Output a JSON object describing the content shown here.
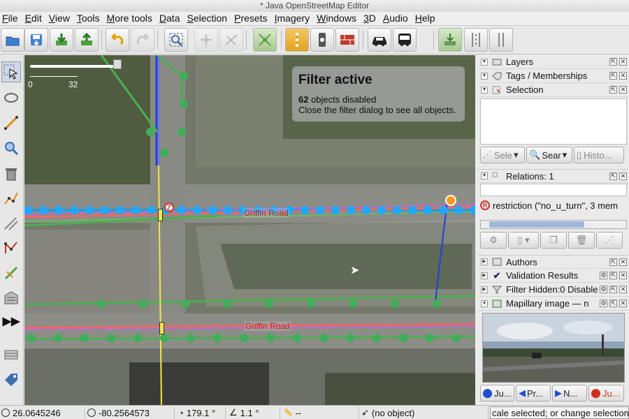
{
  "window": {
    "title": "* Java OpenStreetMap Editor"
  },
  "menu": [
    "File",
    "Edit",
    "View",
    "Tools",
    "More tools",
    "Data",
    "Selection",
    "Presets",
    "Imagery",
    "Windows",
    "3D",
    "Audio",
    "Help"
  ],
  "toolbar_icons": [
    "open-file-icon",
    "save-icon",
    "download-icon",
    "upload-icon",
    "undo-icon",
    "redo-icon",
    "zoom-to-selection-icon",
    "preferences-icon",
    "wireframe-icon",
    "split-way-icon",
    "traffic-signals-icon",
    "railway-crossing-icon",
    "barrier-icon",
    "car-icon",
    "bus-icon",
    "download-bounds-icon",
    "sidewalk-icon",
    "crossing-icon"
  ],
  "left_tools": [
    "select-tool",
    "lasso-tool",
    "draw-nodes-tool",
    "zoom-tool",
    "delete-tool",
    "improve-way-tool",
    "parallel-tool",
    "extrude-tool",
    "join-nodes-tool",
    "building-tool",
    "more-tools",
    "sidebar-toggle",
    "tag-tool"
  ],
  "map": {
    "scale": {
      "start": "0",
      "end": "32"
    },
    "filter": {
      "title": "Filter active",
      "count": "62",
      "line1_suffix": " objects disabled",
      "line2": "Close the filter dialog to see all objects."
    },
    "road_label_top": "Griffin Road",
    "road_label_bottom": "Griffin Road"
  },
  "panels": {
    "layers": "Layers",
    "tags": "Tags / Memberships",
    "selection": "Selection",
    "selection_buttons": [
      "Sele",
      "Sear",
      "Histo..."
    ],
    "relations": "Relations: 1",
    "relation_item": "restriction (\"no_u_turn\", 3 mem",
    "authors": "Authors",
    "validation": "Validation Results",
    "filter_hidden": "Filter Hidden:0 Disable",
    "mapillary": "Mapillary image — n",
    "mapillary_buttons": [
      "Ju...",
      "Pr...",
      "N...",
      "Ju..."
    ]
  },
  "status": {
    "lat": "26.0645246",
    "lon": "-80.2564573",
    "heading": "179.1 °",
    "angle": "1.1 °",
    "distance": "--",
    "object": "(no object)",
    "help": "cale selected; or change selection"
  }
}
